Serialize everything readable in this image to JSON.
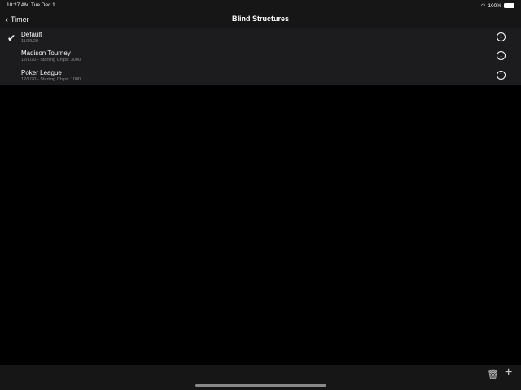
{
  "status": {
    "time": "10:27 AM",
    "date": "Tue Dec 1",
    "battery": "100%"
  },
  "nav": {
    "back_label": "Timer",
    "title": "Blind Structures"
  },
  "items": [
    {
      "name": "Default",
      "subtitle": "11/29/20",
      "selected": true
    },
    {
      "name": "Madison Tourney",
      "subtitle": "12/1/20 - Starting Chips: 3000",
      "selected": false
    },
    {
      "name": "Poker League",
      "subtitle": "12/1/20 - Starting Chips: 1000",
      "selected": false
    }
  ]
}
